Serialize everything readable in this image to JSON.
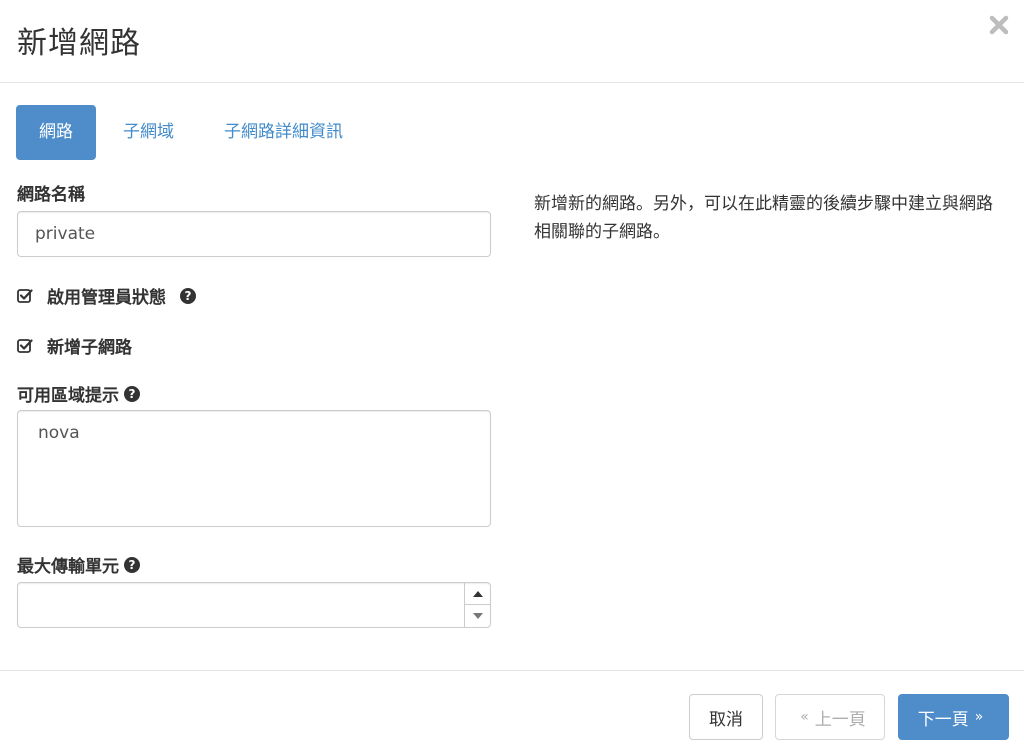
{
  "modal": {
    "title": "新增網路"
  },
  "tabs": [
    {
      "label": "網路",
      "active": true
    },
    {
      "label": "子網域",
      "active": false
    },
    {
      "label": "子網路詳細資訊",
      "active": false
    }
  ],
  "form": {
    "network_name_label": "網路名稱",
    "network_name_value": "private",
    "admin_state_label": "啟用管理員狀態",
    "admin_state_checked": true,
    "create_subnet_label": "新增子網路",
    "create_subnet_checked": true,
    "az_hints_label": "可用區域提示",
    "az_hints_value": "nova",
    "mtu_label": "最大傳輸單元",
    "mtu_value": ""
  },
  "description": "新增新的網路。另外，可以在此精靈的後續步驟中建立與網路相關聯的子網路。",
  "footer": {
    "cancel_label": "取消",
    "back_label": "上一頁",
    "back_chevron": "«",
    "next_label": "下一頁",
    "next_chevron": "»"
  },
  "colors": {
    "accent": "#4e8cca",
    "link": "#428bca"
  },
  "icons": {
    "close": "close-icon",
    "help": "question-circle-icon",
    "checkbox": "check-square-icon"
  }
}
